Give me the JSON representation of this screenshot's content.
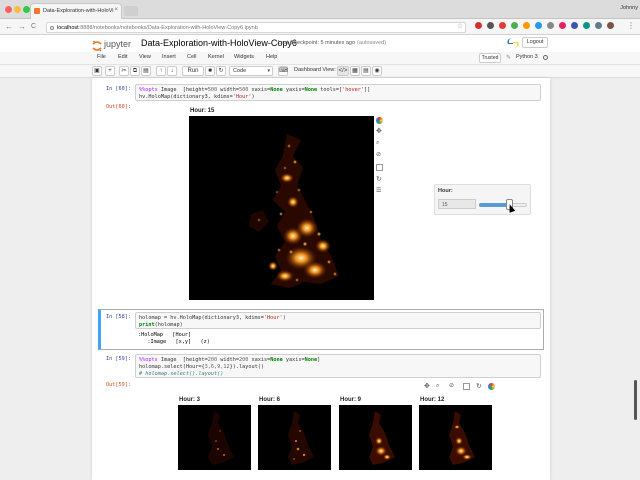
{
  "browser": {
    "tab_title": "Data-Exploration-with-HoloVi",
    "tab_close": "×",
    "url_host": "localhost",
    "url_path": ":8888/notebooks/notebooks/Data-Exploration-with-HoloView-Copy6.ipynb",
    "user": "Johnny",
    "back": "←",
    "forward": "→",
    "reload": "C"
  },
  "header": {
    "logo_text": "jupyter",
    "notebook_name": "Data-Exploration-with-HoloView-Copy6",
    "checkpoint": "Last Checkpoint: 5 minutes ago",
    "autosave": "(autosaved)",
    "logout": "Logout",
    "trusted": "Trusted",
    "kernel": "Python 3"
  },
  "menu": [
    "File",
    "Edit",
    "View",
    "Insert",
    "Cell",
    "Kernel",
    "Widgets",
    "Help"
  ],
  "toolbar": {
    "run_label": "Run",
    "cell_type": "Code",
    "dashboard_label": "Dashboard View:"
  },
  "cells": {
    "c60": {
      "in_prompt": "In [60]:",
      "line1a": "%%opts",
      "line1b": " Image  [height=",
      "line1c": "500",
      "line1d": " width=",
      "line1e": "500",
      "line1f": " xaxis=",
      "line1g": "None",
      "line1h": " yaxis=",
      "line1i": "None",
      "line1j": " tools=[",
      "line1k": "'hover'",
      "line1l": "]]",
      "line2a": "hv.HoloMap(dictionary3, kdims=",
      "line2b": "'Hour'",
      "line2c": ")",
      "out_prompt": "Out[60]:",
      "plot_title": "Hour: 15",
      "widget_label": "Hour:",
      "widget_value": "15"
    },
    "c58": {
      "in_prompt": "In [58]:",
      "line1a": "holomap = hv.HoloMap(dictionary3, kdims=",
      "line1b": "'Hour'",
      "line1c": ")",
      "line2a": "print",
      "line2b": "(holomap)",
      "out1": ":HoloMap   [Hour]",
      "out2": "   :Image   [x,y]   (z)"
    },
    "c59": {
      "in_prompt": "In [59]:",
      "line1a": "%%opts",
      "line1b": " Image  [height=",
      "line1c": "200",
      "line1d": " width=",
      "line1e": "200",
      "line1f": " xaxis=",
      "line1g": "None",
      "line1h": " yaxis=",
      "line1i": "None",
      "line1j": "]",
      "line2a": "holomap.select(Hour={",
      "line2b": "3,6,9,12",
      "line2c": "}).layout()",
      "line3": "# holomap.select().layout()",
      "out_prompt": "Out[59]:",
      "titles": [
        "Hour: 3",
        "Hour: 6",
        "Hour: 9",
        "Hour: 12"
      ]
    }
  },
  "selected_hour": 15,
  "slider_fraction": 0.63,
  "colors": {
    "accent": "#42a5f5",
    "prompt_in": "#303f9f",
    "prompt_out": "#d84315",
    "heat_low": "#3a0a00",
    "heat_mid": "#ff8c00",
    "heat_high": "#ffe9a8"
  },
  "icons": [
    "jupyter-logo-icon",
    "python-logo-icon",
    "bokeh-logo-icon",
    "pan-icon",
    "box-zoom-icon",
    "wheel-zoom-icon",
    "save-icon",
    "reset-icon",
    "hover-icon"
  ]
}
